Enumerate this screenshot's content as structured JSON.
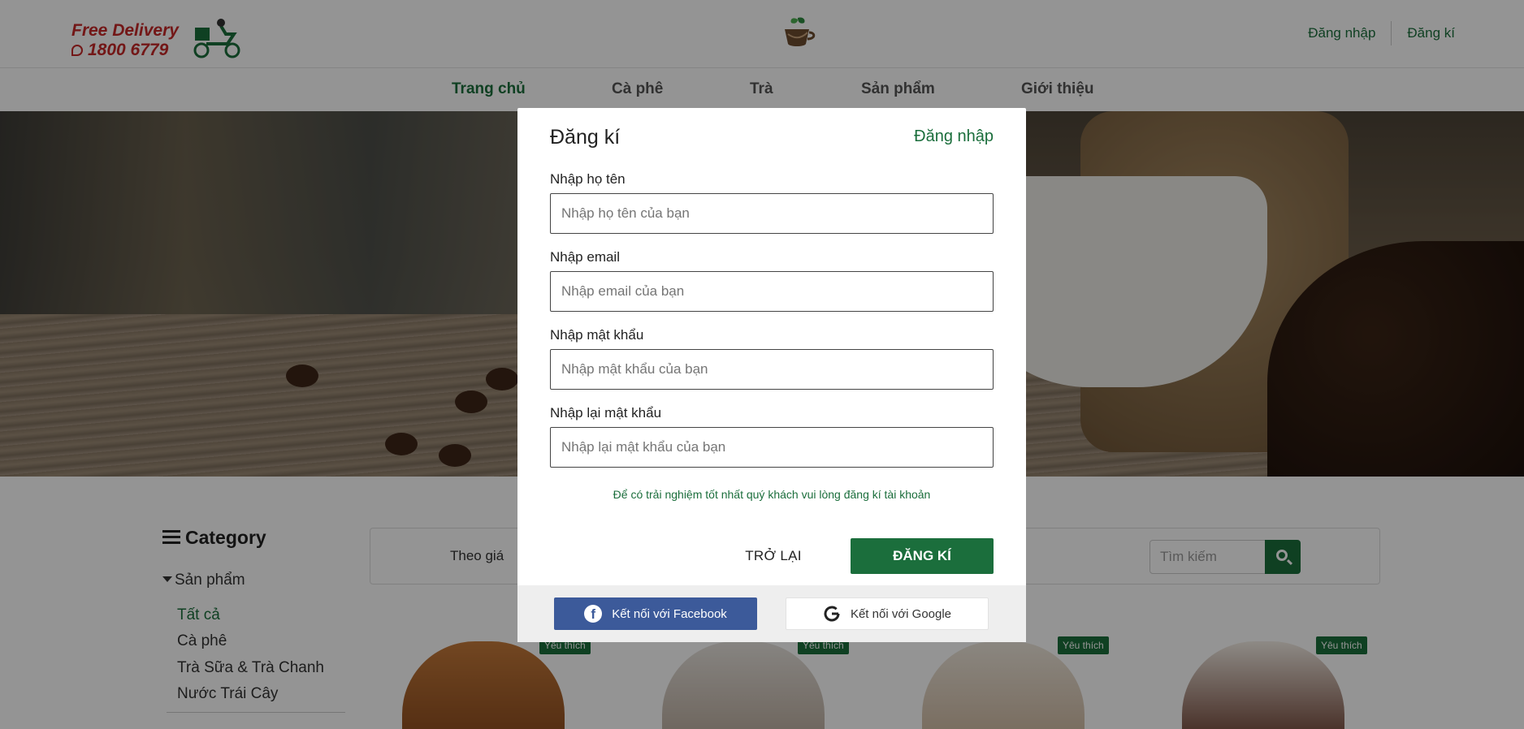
{
  "header": {
    "delivery_line1": "Free Delivery",
    "delivery_line2": "1800 6779",
    "login_link": "Đăng nhập",
    "register_link": "Đăng kí"
  },
  "nav": {
    "items": [
      {
        "label": "Trang chủ",
        "active": true
      },
      {
        "label": "Cà phê"
      },
      {
        "label": "Trà"
      },
      {
        "label": "Sản phẩm"
      },
      {
        "label": "Giới thiệu"
      }
    ]
  },
  "sidebar": {
    "title": "Category",
    "group": "Sản phẩm",
    "items": [
      {
        "label": "Tất cả",
        "active": true
      },
      {
        "label": "Cà phê"
      },
      {
        "label": "Trà Sữa & Trà Chanh"
      },
      {
        "label": "Nước Trái Cây"
      }
    ]
  },
  "filter": {
    "by_price": "Theo giá",
    "search_placeholder": "Tìm kiếm"
  },
  "products": {
    "badge": "Yêu thích"
  },
  "modal": {
    "title": "Đăng kí",
    "login_link": "Đăng nhập",
    "fields": [
      {
        "label": "Nhập họ tên",
        "placeholder": "Nhập họ tên của bạn"
      },
      {
        "label": "Nhập email",
        "placeholder": "Nhập email của bạn"
      },
      {
        "label": "Nhập mật khẩu",
        "placeholder": "Nhập mật khẩu của bạn"
      },
      {
        "label": "Nhập lại mật khẩu",
        "placeholder": "Nhập lại mật khẩu của bạn"
      }
    ],
    "note": "Để có trải nghiệm tốt nhất quý khách vui lòng đăng kí tài khoản",
    "back_label": "TRỞ LẠI",
    "register_label": "ĐĂNG KÍ",
    "facebook_label": "Kết nối với Facebook",
    "google_label": "Kết nối với Google"
  },
  "colors": {
    "brand_green": "#1b6e3c",
    "facebook_blue": "#3c5a9a",
    "delivery_red": "#c62828"
  }
}
